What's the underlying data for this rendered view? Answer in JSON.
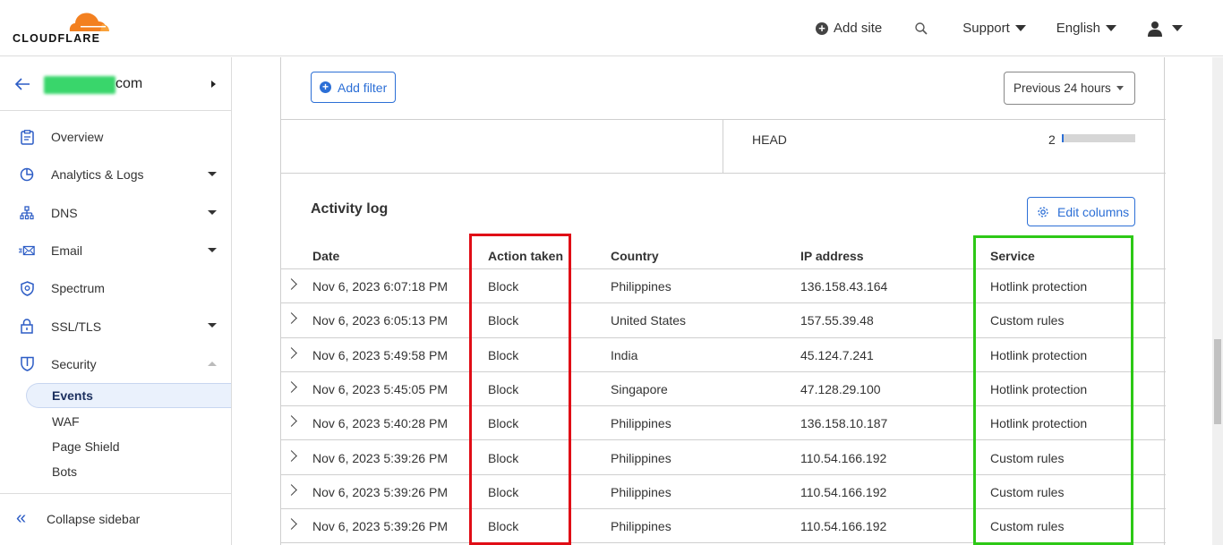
{
  "header": {
    "logo_text": "CLOUDFLARE",
    "brand_color": "#f38020",
    "nav": {
      "add_site": "Add site",
      "search_icon": "search-icon",
      "support": "Support",
      "language": "English",
      "user_icon": "user-icon"
    }
  },
  "sidebar": {
    "zone_suffix": "com",
    "items": [
      {
        "label": "Overview",
        "icon": "clipboard-icon",
        "expandable": false
      },
      {
        "label": "Analytics & Logs",
        "icon": "pie-chart-icon",
        "expandable": true
      },
      {
        "label": "DNS",
        "icon": "network-icon",
        "expandable": true
      },
      {
        "label": "Email",
        "icon": "email-icon",
        "expandable": true
      },
      {
        "label": "Spectrum",
        "icon": "shield-gear-icon",
        "expandable": false
      },
      {
        "label": "SSL/TLS",
        "icon": "lock-icon",
        "expandable": true
      },
      {
        "label": "Security",
        "icon": "shield-icon",
        "expandable": true,
        "expanded": true
      }
    ],
    "sub_items": [
      {
        "label": "Events",
        "active": true
      },
      {
        "label": "WAF",
        "active": false
      },
      {
        "label": "Page Shield",
        "active": false
      },
      {
        "label": "Bots",
        "active": false
      }
    ],
    "collapse_label": "Collapse sidebar"
  },
  "filters": {
    "add_filter": "Add filter",
    "time_range": "Previous 24 hours"
  },
  "method_stats": {
    "method": "HEAD",
    "count": "2",
    "bar_fraction": 0.02
  },
  "activity_log": {
    "title": "Activity log",
    "edit_columns": "Edit columns",
    "columns": [
      "Date",
      "Action taken",
      "Country",
      "IP address",
      "Service"
    ],
    "rows": [
      {
        "date": "Nov 6, 2023 6:07:18 PM",
        "action": "Block",
        "country": "Philippines",
        "ip": "136.158.43.164",
        "service": "Hotlink protection"
      },
      {
        "date": "Nov 6, 2023 6:05:13 PM",
        "action": "Block",
        "country": "United States",
        "ip": "157.55.39.48",
        "service": "Custom rules"
      },
      {
        "date": "Nov 6, 2023 5:49:58 PM",
        "action": "Block",
        "country": "India",
        "ip": "45.124.7.241",
        "service": "Hotlink protection"
      },
      {
        "date": "Nov 6, 2023 5:45:05 PM",
        "action": "Block",
        "country": "Singapore",
        "ip": "47.128.29.100",
        "service": "Hotlink protection"
      },
      {
        "date": "Nov 6, 2023 5:40:28 PM",
        "action": "Block",
        "country": "Philippines",
        "ip": "136.158.10.187",
        "service": "Hotlink protection"
      },
      {
        "date": "Nov 6, 2023 5:39:26 PM",
        "action": "Block",
        "country": "Philippines",
        "ip": "110.54.166.192",
        "service": "Custom rules"
      },
      {
        "date": "Nov 6, 2023 5:39:26 PM",
        "action": "Block",
        "country": "Philippines",
        "ip": "110.54.166.192",
        "service": "Custom rules"
      },
      {
        "date": "Nov 6, 2023 5:39:26 PM",
        "action": "Block",
        "country": "Philippines",
        "ip": "110.54.166.192",
        "service": "Custom rules"
      }
    ]
  },
  "annotations": {
    "action_highlight_color": "#e00d16",
    "service_highlight_color": "#2dc816"
  }
}
